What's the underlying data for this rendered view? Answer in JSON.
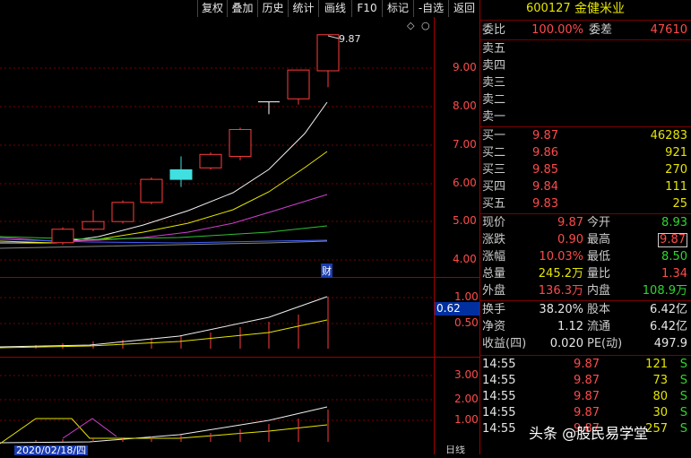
{
  "toolbar": {
    "buttons": [
      "复权",
      "叠加",
      "历史",
      "统计",
      "画线",
      "F10",
      "标记",
      "-自选",
      "返回"
    ]
  },
  "stock": {
    "code": "600127",
    "name": "金健米业"
  },
  "chart": {
    "price_axis": [
      "9.00",
      "8.00",
      "7.00",
      "6.00",
      "5.00",
      "4.00"
    ],
    "high_label": "9.87",
    "fin_badge": "财",
    "vol_axis": [
      "1.00",
      "0.50"
    ],
    "vol_current": "0.62",
    "ind_axis": [
      "3.00",
      "2.00",
      "1.00"
    ],
    "date_label": "2020/02/18/四",
    "axis_unit_label": "日线",
    "candles": [
      {
        "o": 4.25,
        "c": 4.45,
        "h": 4.5,
        "l": 4.2
      },
      {
        "o": 4.45,
        "c": 4.8,
        "h": 4.85,
        "l": 4.4
      },
      {
        "o": 4.8,
        "c": 5.0,
        "h": 5.3,
        "l": 4.75
      },
      {
        "o": 5.0,
        "c": 5.5,
        "h": 5.55,
        "l": 4.95
      },
      {
        "o": 5.5,
        "c": 6.1,
        "h": 6.15,
        "l": 5.45
      },
      {
        "o": 6.1,
        "c": 6.35,
        "h": 6.7,
        "l": 5.9
      },
      {
        "o": 6.4,
        "c": 6.75,
        "h": 6.8,
        "l": 6.35
      },
      {
        "o": 6.7,
        "c": 7.4,
        "h": 7.45,
        "l": 6.6
      },
      {
        "o": 8.12,
        "c": 8.12,
        "h": 8.12,
        "l": 7.8
      },
      {
        "o": 8.2,
        "c": 8.95,
        "h": 8.95,
        "l": 8.05
      },
      {
        "o": 8.93,
        "c": 9.87,
        "h": 9.87,
        "l": 8.5
      }
    ]
  },
  "quote": {
    "weibi_label": "委比",
    "weibi": "100.00%",
    "weicha_label": "委差",
    "weicha": "47610",
    "sell": [
      {
        "label": "卖五"
      },
      {
        "label": "卖四"
      },
      {
        "label": "卖三"
      },
      {
        "label": "卖二"
      },
      {
        "label": "卖一"
      }
    ],
    "buy": [
      {
        "label": "买一",
        "price": "9.87",
        "vol": "46283"
      },
      {
        "label": "买二",
        "price": "9.86",
        "vol": "921"
      },
      {
        "label": "买三",
        "price": "9.85",
        "vol": "270"
      },
      {
        "label": "买四",
        "price": "9.84",
        "vol": "111"
      },
      {
        "label": "买五",
        "price": "9.83",
        "vol": "25"
      }
    ],
    "stats": [
      {
        "l1": "现价",
        "v1": "9.87",
        "c1": "red",
        "l2": "今开",
        "v2": "8.93",
        "c2": "green"
      },
      {
        "l1": "涨跌",
        "v1": "0.90",
        "c1": "red",
        "l2": "最高",
        "v2": "9.87",
        "c2": "red"
      },
      {
        "l1": "涨幅",
        "v1": "10.03%",
        "c1": "red",
        "l2": "最低",
        "v2": "8.50",
        "c2": "green"
      },
      {
        "l1": "总量",
        "v1": "245.2万",
        "c1": "yellow",
        "l2": "量比",
        "v2": "1.34",
        "c2": "red"
      },
      {
        "l1": "外盘",
        "v1": "136.3万",
        "c1": "red",
        "l2": "内盘",
        "v2": "108.9万",
        "c2": "green"
      }
    ],
    "fund": [
      {
        "l1": "换手",
        "v1": "38.20%",
        "l2": "股本",
        "v2": "6.42亿"
      },
      {
        "l1": "净资",
        "v1": "1.12",
        "l2": "流通",
        "v2": "6.42亿"
      },
      {
        "l1": "收益(四)",
        "v1": "0.020",
        "l2": "PE(动)",
        "v2": "497.9"
      }
    ],
    "ticks": [
      {
        "time": "14:55",
        "price": "9.87",
        "vol": "121",
        "flag": "S"
      },
      {
        "time": "14:55",
        "price": "9.87",
        "vol": "73",
        "flag": "S"
      },
      {
        "time": "14:55",
        "price": "9.87",
        "vol": "80",
        "flag": "S"
      },
      {
        "time": "14:55",
        "price": "9.87",
        "vol": "30",
        "flag": "S"
      },
      {
        "time": "14:55",
        "price": "9.87",
        "vol": "257",
        "flag": "S"
      }
    ]
  },
  "watermark": "头条 @股民易学堂"
}
